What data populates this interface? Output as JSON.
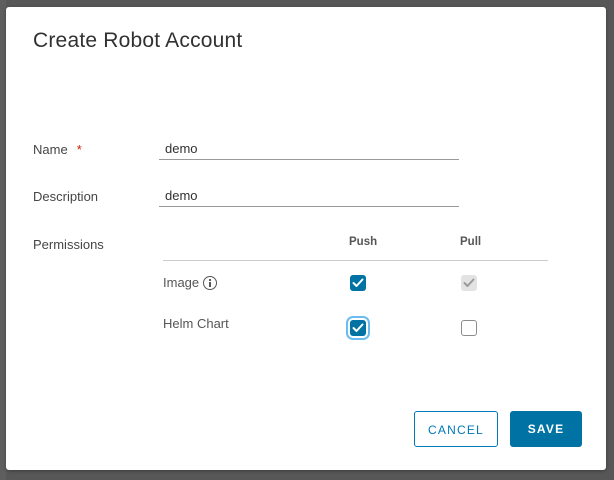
{
  "dialog": {
    "title": "Create Robot Account",
    "name_label": "Name",
    "required_mark": "*",
    "name_value": "demo",
    "description_label": "Description",
    "description_value": "demo",
    "permissions_label": "Permissions",
    "columns": [
      "Push",
      "Pull"
    ],
    "rows": [
      {
        "label": "Image",
        "push": "checked",
        "pull": "checked-disabled"
      },
      {
        "label": "Helm Chart",
        "push": "checked-focused",
        "pull": "unchecked"
      }
    ],
    "cancel_label": "CANCEL",
    "save_label": "SAVE"
  },
  "colors": {
    "primary": "#0072a3",
    "required": "#c92100",
    "backdrop": "#575757"
  },
  "icons": [
    "info-icon",
    "checkmark-icon"
  ]
}
